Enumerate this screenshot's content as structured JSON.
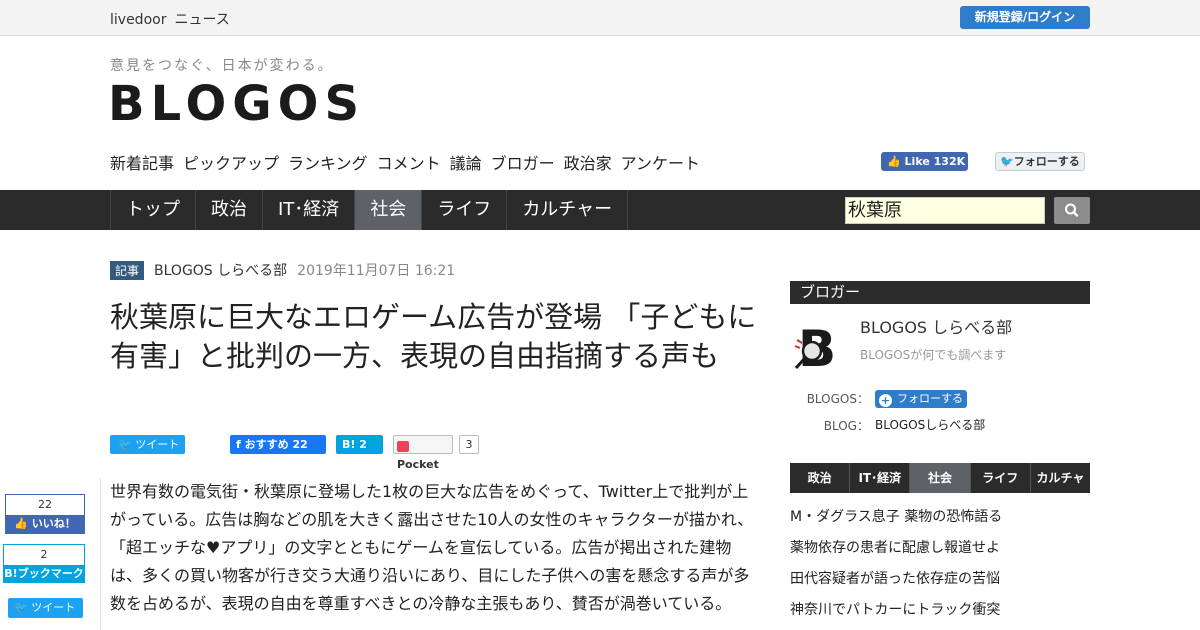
{
  "topbar": {
    "brand_livedoor": "livedoor",
    "brand_news": "ニュース",
    "login": "新規登録/ログイン"
  },
  "header": {
    "tagline": "意見をつなぐ、日本が変わる。",
    "logo": "BLOGOS"
  },
  "subnav": [
    "新着記事",
    "ピックアップ",
    "ランキング",
    "コメント",
    "議論",
    "ブロガー",
    "政治家",
    "アンケート"
  ],
  "social": {
    "fb_like": "Like 132K",
    "tw_follow": "フォローする"
  },
  "mainnav": {
    "tabs": [
      {
        "label": "トップ",
        "active": false
      },
      {
        "label": "政治",
        "active": false
      },
      {
        "label": "IT･経済",
        "active": false
      },
      {
        "label": "社会",
        "active": true
      },
      {
        "label": "ライフ",
        "active": false
      },
      {
        "label": "カルチャー",
        "active": false
      }
    ],
    "search_value": "秋葉原"
  },
  "article": {
    "badge": "記事",
    "author": "BLOGOS しらべる部",
    "date": "2019年11月07日 16:21",
    "title": "秋葉原に巨大なエロゲーム広告が登場 「子どもに有害」と批判の一方、表現の自由指摘する声も",
    "share": {
      "tweet": "ツイート",
      "fb": "おすすめ 22",
      "hb": "2",
      "pocket": "Pocket",
      "pocket_count": "3"
    },
    "body": "世界有数の電気街・秋葉原に登場した1枚の巨大な広告をめぐって、Twitter上で批判が上がっている。広告は胸などの肌を大きく露出させた10人の女性のキャラクターが描かれ、「超エッチな♥アプリ」の文字とともにゲームを宣伝している。広告が掲出された建物は、多くの買い物客が行き交う大通り沿いにあり、目にした子供への害を懸念する声が多数を占めるが、表現の自由を尊重すべきとの冷静な主張もあり、賛否が渦巻いている。"
  },
  "floating": {
    "like_count": "22",
    "like_label": "いいね！",
    "hb_count": "2",
    "hb_label": "B!ブックマーク",
    "tweet": "ツイート"
  },
  "sidebar": {
    "heading": "ブロガー",
    "blogger_name": "BLOGOS しらべる部",
    "blogger_desc": "BLOGOSが何でも調べます",
    "blogos_label": "BLOGOS：",
    "follow": "フォローする",
    "blog_label": "BLOG：",
    "blog_name": "BLOGOSしらべる部",
    "tabs": [
      {
        "label": "政治",
        "active": false
      },
      {
        "label": "IT･経済",
        "active": false
      },
      {
        "label": "社会",
        "active": true
      },
      {
        "label": "ライフ",
        "active": false
      },
      {
        "label": "カルチャー",
        "active": false
      }
    ],
    "list": [
      "M・ダグラス息子 薬物の恐怖語る",
      "薬物依存の患者に配慮し報道せよ",
      "田代容疑者が語った依存症の苦悩",
      "神奈川でパトカーにトラック衝突"
    ]
  },
  "colors": {
    "nav_bg": "#2b2b2b",
    "active_tab": "#5e6166",
    "brand_blue": "#2f7dc8",
    "facebook": "#4267b2",
    "twitter": "#1da1f2",
    "hatena": "#00a4de"
  }
}
